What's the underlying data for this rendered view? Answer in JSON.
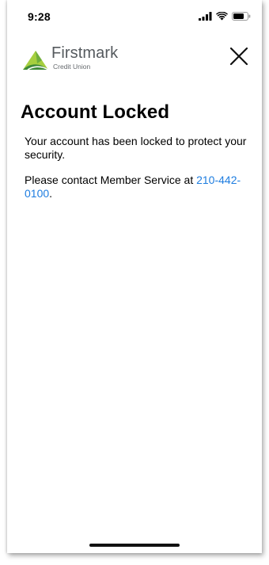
{
  "status_bar": {
    "time": "9:28"
  },
  "header": {
    "logo_name": "Firstmark",
    "logo_subtitle": "Credit Union",
    "close_icon": "close-icon"
  },
  "main": {
    "title": "Account Locked",
    "message": "Your account has been locked to protect your security.",
    "contact_prefix": "Please contact Member Service at ",
    "phone_number": "210-442-0100",
    "contact_suffix": "."
  },
  "colors": {
    "link": "#1e7de0",
    "logo_green_light": "#a6cf3f",
    "logo_green_dark": "#3f8a3a",
    "logo_gray": "#555a5e"
  }
}
